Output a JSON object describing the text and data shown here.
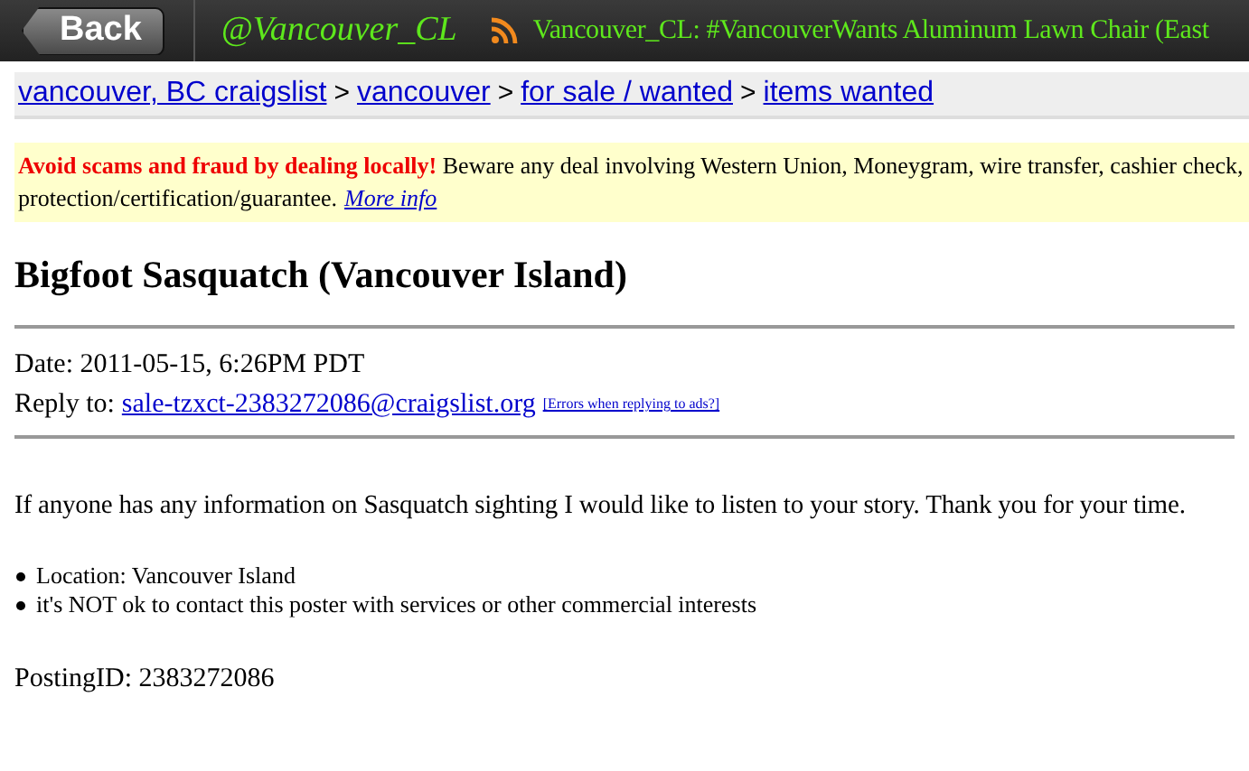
{
  "top_bar": {
    "back_button": "Back",
    "account": "@Vancouver_CL",
    "feed_title": "Vancouver_CL: #VancouverWants Aluminum Lawn Chair (East"
  },
  "breadcrumb": [
    {
      "label": "vancouver, BC craigslist"
    },
    {
      "label": "vancouver"
    },
    {
      "label": "for sale / wanted"
    },
    {
      "label": "items wanted"
    }
  ],
  "breadcrumb_separator": ">",
  "notice": {
    "warning": "Avoid scams and fraud by dealing locally!",
    "line_1": "Beware any deal involving Western Union, Moneygram, wire transfer, cashier check,",
    "line_2": "protection/certification/guarantee.",
    "link": "More info"
  },
  "posting": {
    "title": "Bigfoot Sasquatch (Vancouver Island)",
    "date": "Date: 2011-05-15, 6:26PM PDT",
    "reply_label": "Reply to:",
    "reply_email": "sale-tzxct-2383272086@craigslist.org",
    "errors_link": "[Errors when replying to ads?]",
    "body": "If anyone has any information on Sasquatch sighting I would like to listen to your story. Thank you for your time.",
    "bullets": [
      "Location: Vancouver Island",
      "it's NOT ok to contact this poster with services or other commercial interests"
    ],
    "posting_id": "PostingID: 2383272086"
  }
}
